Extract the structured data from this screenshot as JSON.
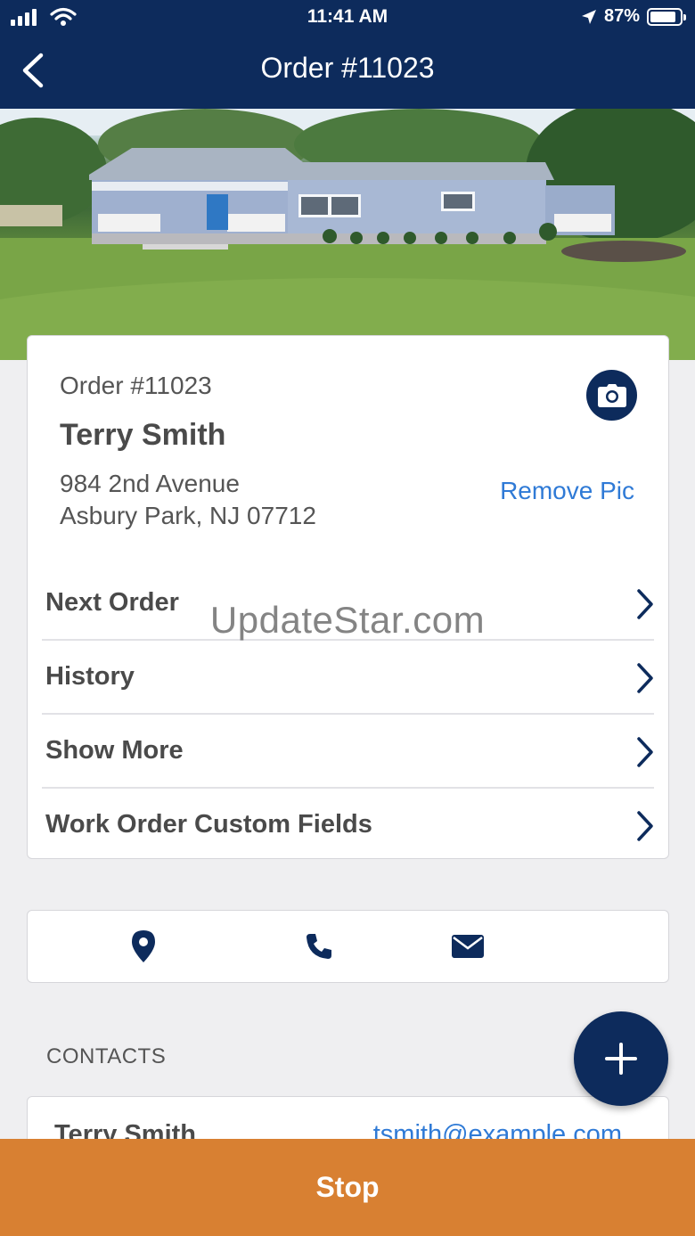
{
  "status_bar": {
    "time": "11:41 AM",
    "battery_percent": "87%",
    "signal_icon": "cellular-signal-icon",
    "wifi_icon": "wifi-icon",
    "location_icon": "location-arrow-icon",
    "battery_icon": "battery-icon"
  },
  "header": {
    "title": "Order #11023",
    "back_icon": "chevron-left-icon"
  },
  "order": {
    "number_label": "Order #11023",
    "customer_name": "Terry Smith",
    "address_line1": "984 2nd Avenue",
    "address_line2": "Asbury Park, NJ 07712",
    "remove_pic_label": "Remove Pic",
    "camera_icon": "camera-icon"
  },
  "menu": {
    "items": [
      {
        "label": "Next Order"
      },
      {
        "label": "History"
      },
      {
        "label": "Show More"
      },
      {
        "label": "Work Order Custom Fields"
      }
    ]
  },
  "watermark": "UpdateStar.com",
  "actions": {
    "icons": [
      "map-pin-icon",
      "phone-icon",
      "envelope-icon"
    ]
  },
  "contacts": {
    "section_label": "CONTACTS",
    "add_icon": "plus-icon",
    "items": [
      {
        "name": "Terry Smith",
        "email": "tsmith@example.com"
      }
    ]
  },
  "footer": {
    "stop_label": "Stop"
  },
  "colors": {
    "brand_navy": "#0d2b5c",
    "link_blue": "#2f7ad6",
    "stop_orange": "#d88032",
    "background": "#efeff1"
  }
}
